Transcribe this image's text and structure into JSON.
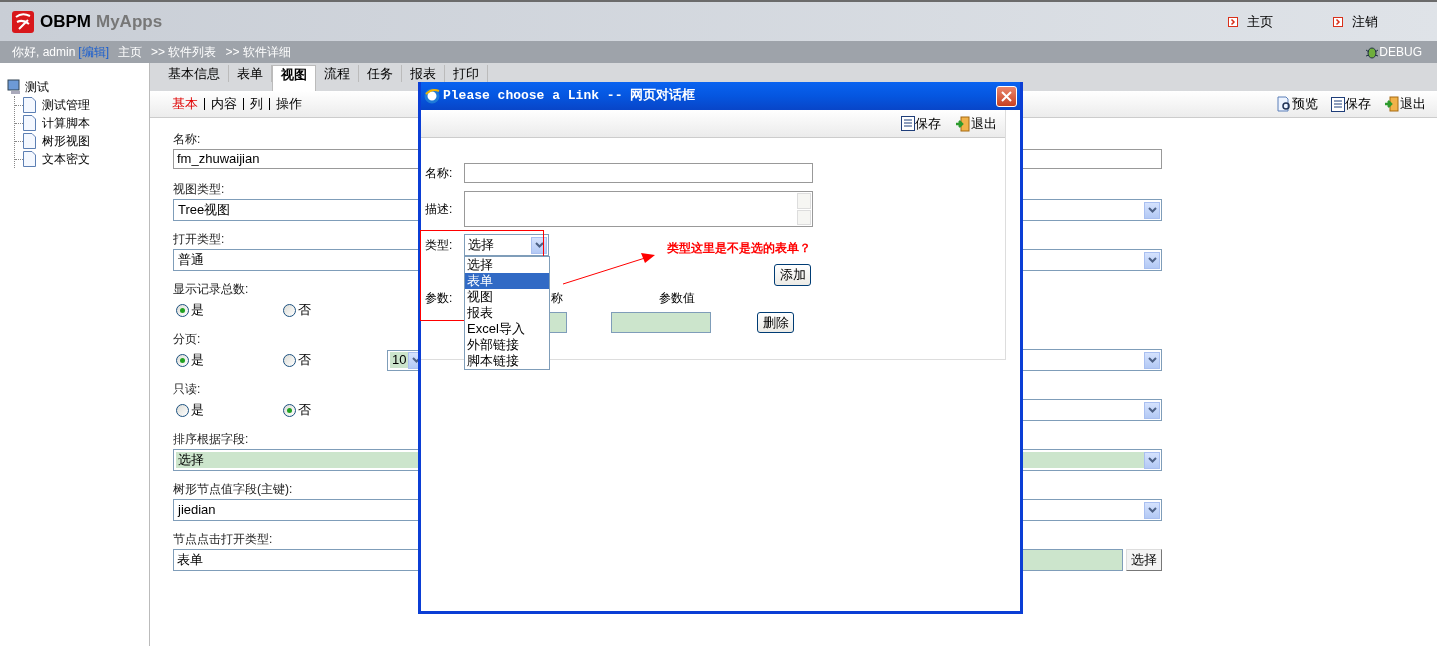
{
  "header": {
    "logo": "OBPM",
    "app_name": "MyApps",
    "links": [
      "主页",
      "注销"
    ]
  },
  "breadcrumb": {
    "greeting": "你好, admin",
    "edit_link": "[编辑]",
    "items": [
      "主页",
      ">> 软件列表",
      ">> 软件详细"
    ],
    "debug": "DEBUG"
  },
  "sidebar": {
    "label": "测试",
    "children": [
      {
        "label": "测试管理"
      },
      {
        "label": "计算脚本"
      },
      {
        "label": "树形视图"
      },
      {
        "label": "文本密文"
      }
    ]
  },
  "tabs": [
    {
      "label": "基本信息",
      "selected": false
    },
    {
      "label": "表单",
      "selected": false
    },
    {
      "label": "视图",
      "selected": true
    },
    {
      "label": "流程",
      "selected": false
    },
    {
      "label": "任务",
      "selected": false
    },
    {
      "label": "报表",
      "selected": false
    },
    {
      "label": "打印",
      "selected": false
    }
  ],
  "subtabs": [
    {
      "label": "基本",
      "selected": true
    },
    {
      "label": "内容",
      "selected": false
    },
    {
      "label": "列",
      "selected": false
    },
    {
      "label": "操作",
      "selected": false
    }
  ],
  "actions": [
    "预览",
    "保存",
    "退出"
  ],
  "form": [
    {
      "kind": "text",
      "label": "名称:",
      "value": "fm_zhuwaijian"
    },
    {
      "kind": "select",
      "label": "视图类型:",
      "value": "Tree视图",
      "highlighted": false
    },
    {
      "kind": "select",
      "label": "打开类型:",
      "value": "普通",
      "highlighted": false
    },
    {
      "kind": "radio",
      "label": "显示记录总数:",
      "options": [
        {
          "label": "是",
          "selected": true
        },
        {
          "label": "否",
          "selected": false
        }
      ],
      "extra_select": false
    },
    {
      "kind": "radio",
      "label": "分页:",
      "options": [
        {
          "label": "是",
          "selected": true
        },
        {
          "label": "否",
          "selected": false
        }
      ],
      "page_size": "10",
      "extra_select": true
    },
    {
      "kind": "radio",
      "label": "只读:",
      "options": [
        {
          "label": "是",
          "selected": false
        },
        {
          "label": "否",
          "selected": true
        }
      ],
      "extra_select": true
    },
    {
      "kind": "select",
      "label": "排序根据字段:",
      "value": "选择",
      "highlighted": true
    },
    {
      "kind": "select",
      "label": "树形节点值字段(主键):",
      "value": "jiedian",
      "highlighted": false
    },
    {
      "kind": "picker",
      "label": "节点点击打开类型:",
      "value": "表单",
      "button": "选择"
    }
  ],
  "dialog": {
    "title": "Please choose a Link -- 网页对话框",
    "toolbar": [
      "保存",
      "退出"
    ],
    "name_label": "名称:",
    "desc_label": "描述:",
    "type_label": "类型:",
    "type_value": "选择",
    "type_options": [
      {
        "label": "选择",
        "selected": false
      },
      {
        "label": "表单",
        "selected": true
      },
      {
        "label": "视图",
        "selected": false
      },
      {
        "label": "报表",
        "selected": false
      },
      {
        "label": "Excel导入",
        "selected": false
      },
      {
        "label": "外部链接",
        "selected": false
      },
      {
        "label": "脚本链接",
        "selected": false
      }
    ],
    "add_button": "添加",
    "params_label": "参数:",
    "param_columns": [
      "称",
      "参数值"
    ],
    "delete_button": "删除",
    "annotation": "类型这里是不是选的表单？"
  }
}
